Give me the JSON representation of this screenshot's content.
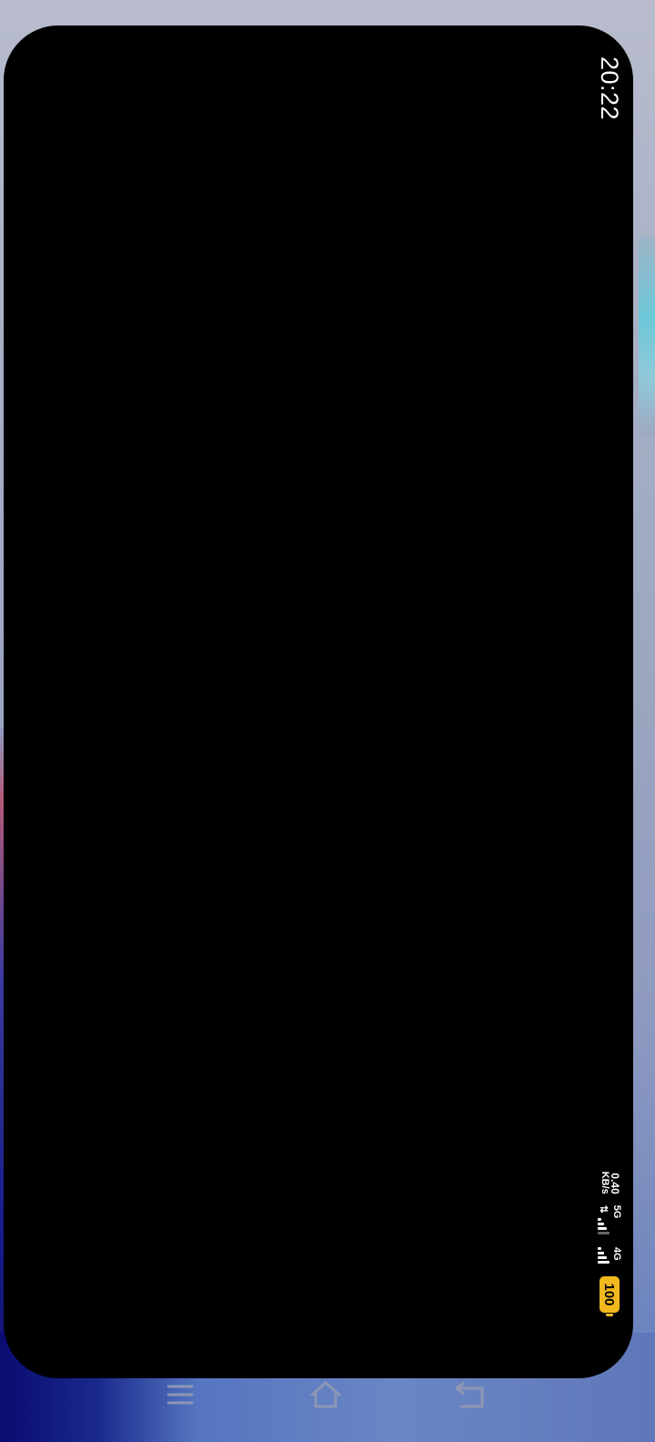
{
  "status_bar": {
    "time": "20:22",
    "net_speed_value": "0.40",
    "net_speed_unit": "KB/s",
    "signal_1_label": "5G",
    "signal_1_arrows": "⇅",
    "signal_2_label": "4G",
    "battery_level": "100",
    "battery_color": "#f2b81d"
  },
  "navigation": {
    "icons": [
      "menu-icon",
      "home-icon",
      "back-icon"
    ]
  },
  "colors": {
    "card_background": "#000000",
    "nav_icon": "#8d97b4"
  }
}
